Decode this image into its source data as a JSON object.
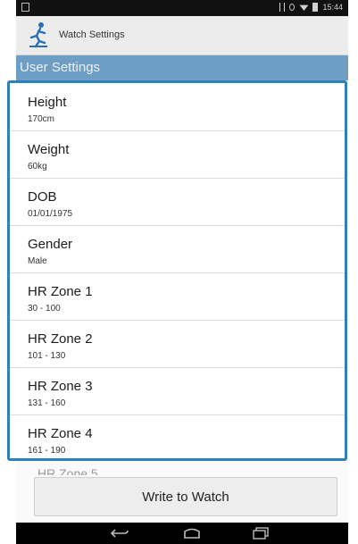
{
  "status_bar": {
    "time": "15:44"
  },
  "action_bar": {
    "title": "Watch Settings",
    "app_icon": "runner-icon"
  },
  "section_header": {
    "title": "User Settings"
  },
  "settings": [
    {
      "label": "Height",
      "value": "170cm"
    },
    {
      "label": "Weight",
      "value": "60kg"
    },
    {
      "label": "DOB",
      "value": "01/01/1975"
    },
    {
      "label": "Gender",
      "value": "Male"
    },
    {
      "label": "HR Zone 1",
      "value": "30 - 100"
    },
    {
      "label": "HR Zone 2",
      "value": "101 - 130"
    },
    {
      "label": "HR Zone 3",
      "value": "131 - 160"
    },
    {
      "label": "HR Zone 4",
      "value": "161 - 190"
    }
  ],
  "peek_item": {
    "label": "HR Zone 5"
  },
  "write_button": {
    "label": "Write to Watch"
  },
  "nav_bar": {
    "icons": [
      "back-icon",
      "home-icon",
      "recent-apps-icon"
    ]
  },
  "colors": {
    "section_header": "#6f9ec5",
    "highlight_frame": "#2f80b8",
    "status_bar": "#111111"
  }
}
